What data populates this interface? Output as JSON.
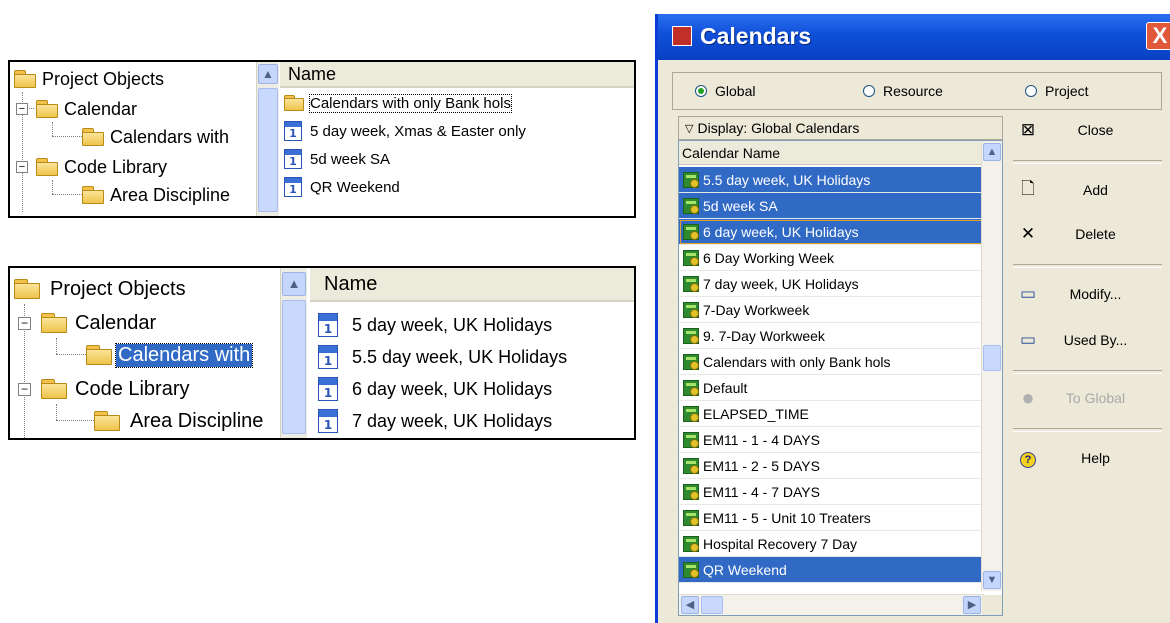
{
  "explorer_top": {
    "tree": {
      "root_label": "Project Objects",
      "items": [
        {
          "label": "Calendar",
          "level": 1,
          "expander": "−"
        },
        {
          "label": "Calendars with",
          "level": 2
        },
        {
          "label": "Code Library",
          "level": 1,
          "expander": "−"
        },
        {
          "label": "Area Discipline",
          "level": 2
        }
      ]
    },
    "list": {
      "header": "Name",
      "rows": [
        {
          "label": "Calendars with only Bank hols",
          "icon": "folder-icon",
          "focused": true
        },
        {
          "label": "5 day week, Xmas & Easter only",
          "icon": "calendar-icon"
        },
        {
          "label": "5d week SA",
          "icon": "calendar-icon"
        },
        {
          "label": "QR Weekend",
          "icon": "calendar-icon"
        }
      ]
    }
  },
  "explorer_bottom": {
    "tree": {
      "root_label": "Project Objects",
      "items": [
        {
          "label": "Calendar",
          "level": 1,
          "expander": "−"
        },
        {
          "label": "Calendars with",
          "level": 2,
          "selected": true
        },
        {
          "label": "Code Library",
          "level": 1,
          "expander": "−"
        },
        {
          "label": "Area Discipline",
          "level": 2
        }
      ]
    },
    "list": {
      "header": "Name",
      "rows": [
        {
          "label": "5 day week, UK Holidays",
          "icon": "calendar-icon"
        },
        {
          "label": "5.5 day week, UK Holidays",
          "icon": "calendar-icon"
        },
        {
          "label": "6 day week, UK Holidays",
          "icon": "calendar-icon"
        },
        {
          "label": "7 day week, UK Holidays",
          "icon": "calendar-icon"
        }
      ]
    }
  },
  "dialog": {
    "title": "Calendars",
    "close_glyph": "X",
    "radios": [
      {
        "label": "Global",
        "checked": true
      },
      {
        "label": "Resource",
        "checked": false
      },
      {
        "label": "Project",
        "checked": false
      }
    ],
    "display_label": "Display: Global Calendars",
    "column_header": "Calendar Name",
    "calendars": [
      {
        "name": "5.5 day week, UK Holidays",
        "selected": true
      },
      {
        "name": "5d week SA",
        "selected": true
      },
      {
        "name": "6 day week, UK Holidays",
        "selected": true,
        "focused": true
      },
      {
        "name": "6 Day Working Week"
      },
      {
        "name": "7 day week, UK Holidays"
      },
      {
        "name": "7-Day Workweek"
      },
      {
        "name": "9. 7-Day Workweek"
      },
      {
        "name": "Calendars with only Bank hols"
      },
      {
        "name": "Default"
      },
      {
        "name": "ELAPSED_TIME"
      },
      {
        "name": "EM11 - 1 - 4 DAYS"
      },
      {
        "name": "EM11 - 2 - 5 DAYS"
      },
      {
        "name": "EM11 - 4 - 7 DAYS"
      },
      {
        "name": "EM11 - 5 - Unit 10 Treaters"
      },
      {
        "name": "Hospital Recovery 7 Day"
      },
      {
        "name": "QR Weekend",
        "selected": true
      }
    ],
    "buttons": [
      {
        "label": "Close",
        "icon": "close-window-icon",
        "glyph": "⊠"
      },
      {
        "label": "Add",
        "icon": "new-page-icon",
        "glyph": "🗋"
      },
      {
        "label": "Delete",
        "icon": "delete-x-icon",
        "glyph": "✕"
      },
      {
        "label": "Modify...",
        "icon": "modify-window-icon",
        "glyph": "▭"
      },
      {
        "label": "Used By...",
        "icon": "used-by-window-icon",
        "glyph": "▭"
      },
      {
        "label": "To Global",
        "icon": "globe-icon",
        "glyph": "●",
        "disabled": true
      },
      {
        "label": "Help",
        "icon": "help-icon",
        "glyph": "?"
      }
    ],
    "colors": {
      "selection": "#316ac5",
      "titlebar": "#0f4fd8",
      "dialog_bg": "#ece9d8"
    }
  }
}
